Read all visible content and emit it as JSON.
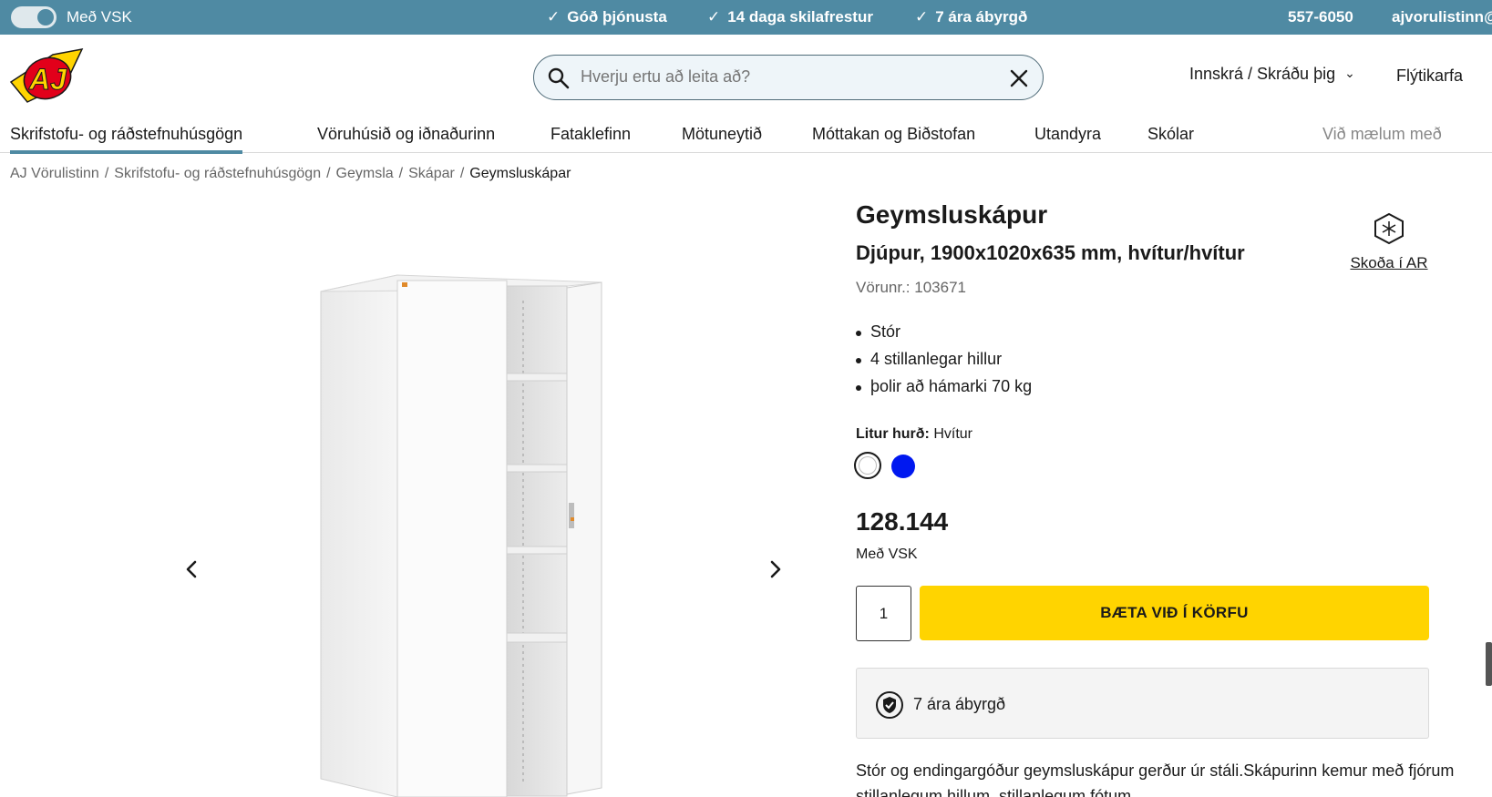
{
  "topbar": {
    "vat_toggle_label": "Með VSK",
    "usps": [
      "Góð þjónusta",
      "14 daga skilafrestur",
      "7 ára ábyrgð"
    ],
    "phone": "557-6050",
    "email": "ajvorulistinn@"
  },
  "header": {
    "logo_text": "AJ",
    "search_placeholder": "Hverju ertu að leita að?",
    "login_label": "Innskrá / Skráðu þig",
    "cart_label": "Flýtikarfa"
  },
  "nav": {
    "items": [
      "Skrifstofu- og ráðstefnuhúsgögn",
      "Vöruhúsið og iðnaðurinn",
      "Fataklefinn",
      "Mötuneytið",
      "Móttakan og Biðstofan",
      "Utandyra",
      "Skólar",
      "Við mælum með"
    ],
    "active_index": 0
  },
  "breadcrumb": {
    "items": [
      "AJ Vörulistinn",
      "Skrifstofu- og ráðstefnuhúsgögn",
      "Geymsla",
      "Skápar"
    ],
    "current": "Geymsluskápar",
    "separator": "/"
  },
  "product": {
    "title": "Geymsluskápur",
    "subtitle": "Djúpur, 1900x1020x635 mm, hvítur/hvítur",
    "sku": "Vörunr.: 103671",
    "ar_label": "Skoða í AR",
    "bullets": [
      "Stór",
      "4 stillanlegar hillur",
      "þolir að hámarki 70 kg"
    ],
    "color_label": "Litur hurð:",
    "color_value": "Hvítur",
    "swatches": [
      {
        "name": "white",
        "color": "#ffffff"
      },
      {
        "name": "blue",
        "color": "#0018f0"
      }
    ],
    "price": "128.144",
    "price_note": "Með VSK",
    "quantity": "1",
    "add_to_cart": "BÆTA VIÐ Í KÖRFU",
    "warranty": "7 ára ábyrgð",
    "description": "Stór og endingargóður geymsluskápur gerður úr stáli.Skápurinn kemur með fjórum stillanlegum hillum, stillanlegum fótum"
  },
  "colors": {
    "topbar": "#4f8aa3",
    "cta": "#ffd400",
    "swatch_blue": "#0018f0",
    "logo_red": "#e2001a",
    "logo_yellow": "#ffd400"
  }
}
